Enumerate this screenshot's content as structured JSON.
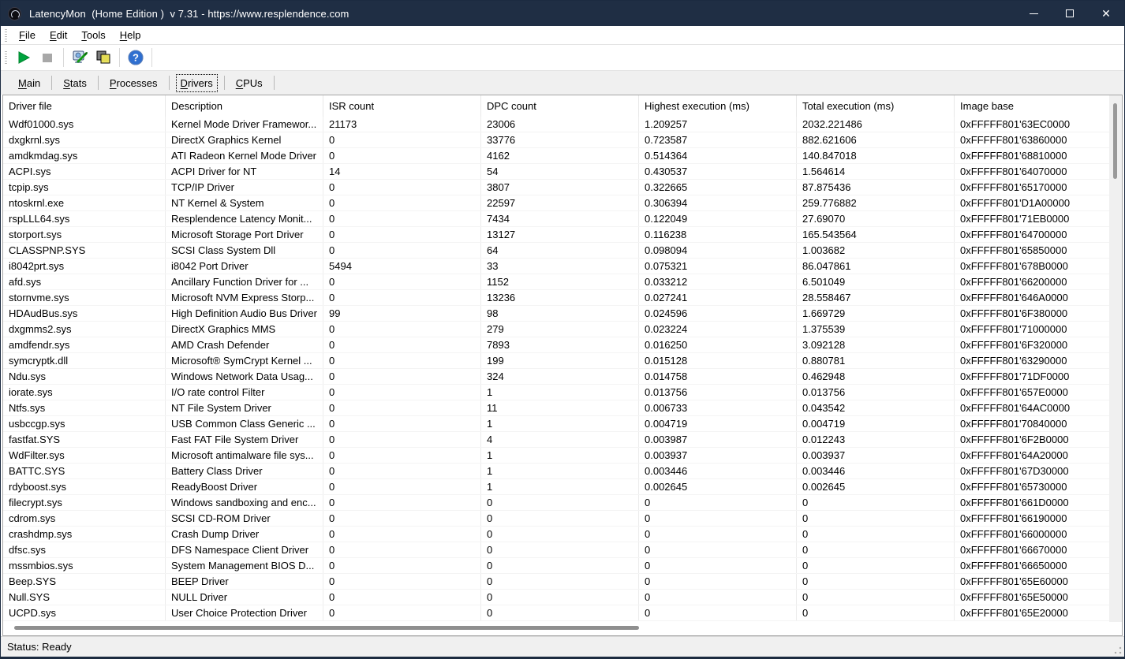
{
  "window": {
    "title": "LatencyMon  (Home Edition )  v 7.31 - https://www.resplendence.com"
  },
  "menu": {
    "items": [
      {
        "label": "File"
      },
      {
        "label": "Edit"
      },
      {
        "label": "Tools"
      },
      {
        "label": "Help"
      }
    ]
  },
  "toolbar": {
    "buttons": [
      {
        "name": "start-monitor",
        "icon": "play-icon"
      },
      {
        "name": "stop-monitor",
        "icon": "stop-icon"
      },
      {
        "name": "options",
        "icon": "monitor-tool-icon"
      },
      {
        "name": "copy-report",
        "icon": "copy-icon"
      },
      {
        "name": "help",
        "icon": "help-icon"
      }
    ]
  },
  "tabs": {
    "items": [
      {
        "label": "Main",
        "selected": false
      },
      {
        "label": "Stats",
        "selected": false
      },
      {
        "label": "Processes",
        "selected": false
      },
      {
        "label": "Drivers",
        "selected": true
      },
      {
        "label": "CPUs",
        "selected": false
      }
    ]
  },
  "table": {
    "columns": [
      "Driver file",
      "Description",
      "ISR count",
      "DPC count",
      "Highest execution (ms)",
      "Total execution (ms)",
      "Image base"
    ],
    "rows": [
      [
        "Wdf01000.sys",
        "Kernel Mode Driver Framewor...",
        "21173",
        "23006",
        "1.209257",
        "2032.221486",
        "0xFFFFF801'63EC0000"
      ],
      [
        "dxgkrnl.sys",
        "DirectX Graphics Kernel",
        "0",
        "33776",
        "0.723587",
        "882.621606",
        "0xFFFFF801'63860000"
      ],
      [
        "amdkmdag.sys",
        "ATI Radeon Kernel Mode Driver",
        "0",
        "4162",
        "0.514364",
        "140.847018",
        "0xFFFFF801'68810000"
      ],
      [
        "ACPI.sys",
        "ACPI Driver for NT",
        "14",
        "54",
        "0.430537",
        "1.564614",
        "0xFFFFF801'64070000"
      ],
      [
        "tcpip.sys",
        "TCP/IP Driver",
        "0",
        "3807",
        "0.322665",
        "87.875436",
        "0xFFFFF801'65170000"
      ],
      [
        "ntoskrnl.exe",
        "NT Kernel & System",
        "0",
        "22597",
        "0.306394",
        "259.776882",
        "0xFFFFF801'D1A00000"
      ],
      [
        "rspLLL64.sys",
        "Resplendence Latency Monit...",
        "0",
        "7434",
        "0.122049",
        "27.69070",
        "0xFFFFF801'71EB0000"
      ],
      [
        "storport.sys",
        "Microsoft Storage Port Driver",
        "0",
        "13127",
        "0.116238",
        "165.543564",
        "0xFFFFF801'64700000"
      ],
      [
        "CLASSPNP.SYS",
        "SCSI Class System Dll",
        "0",
        "64",
        "0.098094",
        "1.003682",
        "0xFFFFF801'65850000"
      ],
      [
        "i8042prt.sys",
        "i8042 Port Driver",
        "5494",
        "33",
        "0.075321",
        "86.047861",
        "0xFFFFF801'678B0000"
      ],
      [
        "afd.sys",
        "Ancillary Function Driver for ...",
        "0",
        "1152",
        "0.033212",
        "6.501049",
        "0xFFFFF801'66200000"
      ],
      [
        "stornvme.sys",
        "Microsoft NVM Express Storp...",
        "0",
        "13236",
        "0.027241",
        "28.558467",
        "0xFFFFF801'646A0000"
      ],
      [
        "HDAudBus.sys",
        "High Definition Audio Bus Driver",
        "99",
        "98",
        "0.024596",
        "1.669729",
        "0xFFFFF801'6F380000"
      ],
      [
        "dxgmms2.sys",
        "DirectX Graphics MMS",
        "0",
        "279",
        "0.023224",
        "1.375539",
        "0xFFFFF801'71000000"
      ],
      [
        "amdfendr.sys",
        "AMD Crash Defender",
        "0",
        "7893",
        "0.016250",
        "3.092128",
        "0xFFFFF801'6F320000"
      ],
      [
        "symcryptk.dll",
        "Microsoft® SymCrypt Kernel ...",
        "0",
        "199",
        "0.015128",
        "0.880781",
        "0xFFFFF801'63290000"
      ],
      [
        "Ndu.sys",
        "Windows Network Data Usag...",
        "0",
        "324",
        "0.014758",
        "0.462948",
        "0xFFFFF801'71DF0000"
      ],
      [
        "iorate.sys",
        "I/O rate control Filter",
        "0",
        "1",
        "0.013756",
        "0.013756",
        "0xFFFFF801'657E0000"
      ],
      [
        "Ntfs.sys",
        "NT File System Driver",
        "0",
        "11",
        "0.006733",
        "0.043542",
        "0xFFFFF801'64AC0000"
      ],
      [
        "usbccgp.sys",
        "USB Common Class Generic ...",
        "0",
        "1",
        "0.004719",
        "0.004719",
        "0xFFFFF801'70840000"
      ],
      [
        "fastfat.SYS",
        "Fast FAT File System Driver",
        "0",
        "4",
        "0.003987",
        "0.012243",
        "0xFFFFF801'6F2B0000"
      ],
      [
        "WdFilter.sys",
        "Microsoft antimalware file sys...",
        "0",
        "1",
        "0.003937",
        "0.003937",
        "0xFFFFF801'64A20000"
      ],
      [
        "BATTC.SYS",
        "Battery Class Driver",
        "0",
        "1",
        "0.003446",
        "0.003446",
        "0xFFFFF801'67D30000"
      ],
      [
        "rdyboost.sys",
        "ReadyBoost Driver",
        "0",
        "1",
        "0.002645",
        "0.002645",
        "0xFFFFF801'65730000"
      ],
      [
        "filecrypt.sys",
        "Windows sandboxing and enc...",
        "0",
        "0",
        "0",
        "0",
        "0xFFFFF801'661D0000"
      ],
      [
        "cdrom.sys",
        "SCSI CD-ROM Driver",
        "0",
        "0",
        "0",
        "0",
        "0xFFFFF801'66190000"
      ],
      [
        "crashdmp.sys",
        "Crash Dump Driver",
        "0",
        "0",
        "0",
        "0",
        "0xFFFFF801'66000000"
      ],
      [
        "dfsc.sys",
        "DFS Namespace Client Driver",
        "0",
        "0",
        "0",
        "0",
        "0xFFFFF801'66670000"
      ],
      [
        "mssmbios.sys",
        "System Management BIOS D...",
        "0",
        "0",
        "0",
        "0",
        "0xFFFFF801'66650000"
      ],
      [
        "Beep.SYS",
        "BEEP Driver",
        "0",
        "0",
        "0",
        "0",
        "0xFFFFF801'65E60000"
      ],
      [
        "Null.SYS",
        "NULL Driver",
        "0",
        "0",
        "0",
        "0",
        "0xFFFFF801'65E50000"
      ],
      [
        "UCPD.sys",
        "User Choice Protection Driver",
        "0",
        "0",
        "0",
        "0",
        "0xFFFFF801'65E20000"
      ]
    ]
  },
  "statusbar": {
    "text": "Status: Ready"
  },
  "colors": {
    "titlebar": "#1f2e44",
    "tabstrip_bg": "#f0f0f0",
    "play_green": "#00a33e",
    "stop_gray": "#a8a8a8",
    "help_blue": "#2f6fd0",
    "copy_yellow": "#efe96e"
  }
}
